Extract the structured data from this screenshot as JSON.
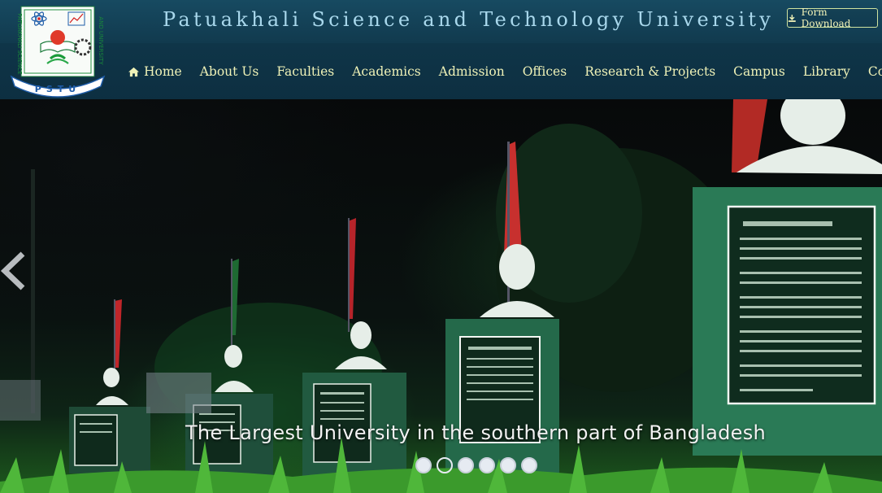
{
  "header": {
    "title": "Patuakhali Science and Technology University",
    "logo_text": "PATUAKHALI SCIENCE AND TECHNOLOGY UNIVERSITY",
    "logo_abbrev": "P S T U",
    "form_download_label": "Form Download",
    "form_download_icon": "download-icon"
  },
  "nav": {
    "home": "Home",
    "home_icon": "home-icon",
    "items": [
      "About Us",
      "Faculties",
      "Academics",
      "Admission",
      "Offices",
      "Research & Projects",
      "Campus",
      "Library",
      "Convocation"
    ]
  },
  "slider": {
    "caption": "The Largest University in the southern part of Bangladesh",
    "slide_count": 6,
    "active_slide": 2,
    "prev_icon": "chevron-left-icon"
  },
  "colors": {
    "header_bg": "#0f3548",
    "title": "#a9d8ec",
    "nav_text": "#eef1b7"
  }
}
